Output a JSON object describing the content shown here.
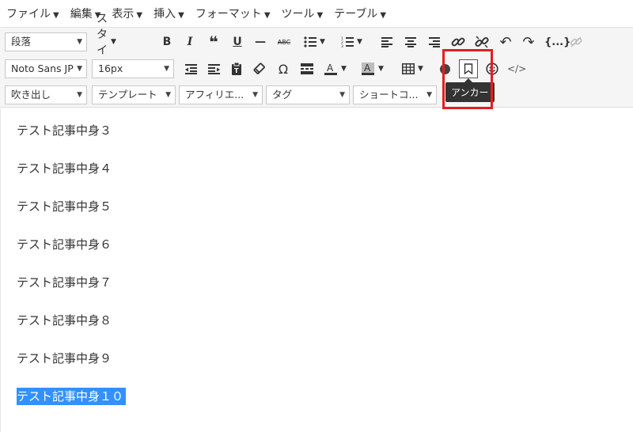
{
  "menu": [
    "ファイル",
    "編集",
    "表示",
    "挿入",
    "フォーマット",
    "ツール",
    "テーブル"
  ],
  "toolbar": {
    "format_select": "段落",
    "style_label": "スタイル",
    "font_family": "Noto Sans JP",
    "font_size": "16px",
    "speech_bubble": "吹き出し",
    "template": "テンプレート",
    "affiliate": "アフィリエ...",
    "tag": "タグ",
    "shortcode": "ショートコ...",
    "code_label": "{...}"
  },
  "tooltip": "アンカー",
  "editor": {
    "paragraphs": [
      "テスト記事中身３",
      "テスト記事中身４",
      "テスト記事中身５",
      "テスト記事中身６",
      "テスト記事中身７",
      "テスト記事中身８",
      "テスト記事中身９",
      "テスト記事中身１０"
    ]
  },
  "colors": {
    "toolbar_bg": "#f5f5f5",
    "selection": "#3390ff",
    "highlight": "#e02020",
    "tooltip_bg": "#333333"
  }
}
